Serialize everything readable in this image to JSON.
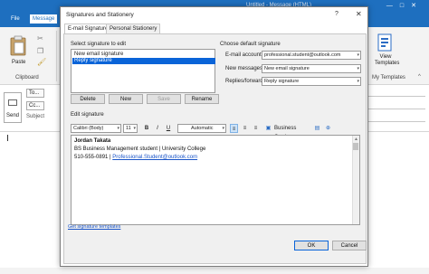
{
  "outlook": {
    "title_partial": "Untitled - Message (HTML)",
    "tabs": [
      "File",
      "Message"
    ],
    "clipboard": {
      "paste_label": "Paste",
      "group_label": "Clipboard"
    },
    "view_templates": {
      "label": "View Templates",
      "group_label": "My Templates"
    },
    "compose": {
      "send_label": "Send",
      "to_label": "To...",
      "cc_label": "Cc...",
      "subject_label": "Subject"
    }
  },
  "dialog": {
    "title": "Signatures and Stationery",
    "help_label": "?",
    "tabs": [
      "E-mail Signature",
      "Personal Stationery"
    ],
    "select_label": "Select signature to edit",
    "signatures": [
      "New email signature",
      "Reply signature"
    ],
    "selected_index": 1,
    "buttons": {
      "delete": "Delete",
      "new": "New",
      "save": "Save",
      "rename": "Rename"
    },
    "default_section": {
      "heading": "Choose default signature",
      "email_account_label": "E-mail account:",
      "email_account_value": "professional.student@outlook.com",
      "new_messages_label": "New messages:",
      "new_messages_value": "New email signature",
      "replies_label": "Replies/forwards:",
      "replies_value": "Reply signature"
    },
    "edit_label": "Edit signature",
    "toolbar": {
      "font": "Calibri (Body)",
      "size": "11",
      "bold": "B",
      "italic": "I",
      "underline": "U",
      "color": "Automatic",
      "business_card": "Business Card"
    },
    "signature": {
      "name": "Jordan Takata",
      "line2": "BS Business Management student | University College",
      "phone": "510-555-0891 | ",
      "email": "Professional.Student@outlook.com"
    },
    "templates_link": "Get signature templates",
    "ok": "OK",
    "cancel": "Cancel"
  }
}
